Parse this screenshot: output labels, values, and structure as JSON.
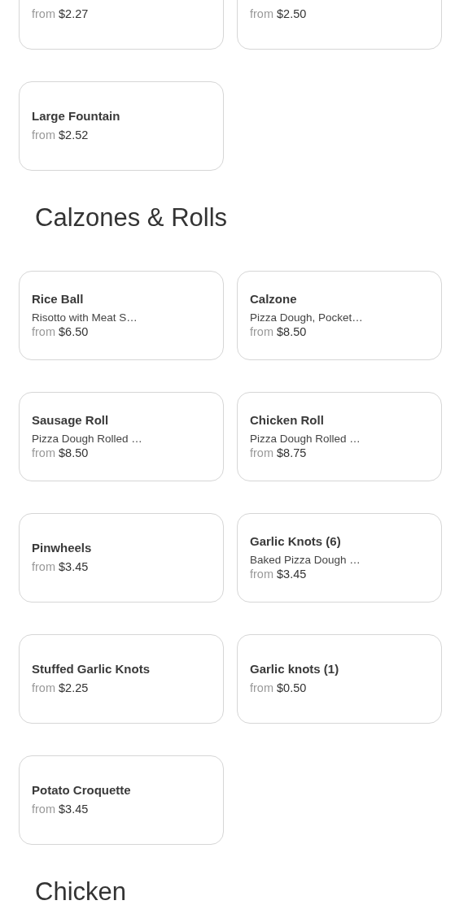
{
  "sections": [
    {
      "items": [
        {
          "from_label": "from",
          "price": "$2.27"
        },
        {
          "from_label": "from",
          "price": "$2.50"
        },
        {
          "name": "Large Fountain",
          "from_label": "from",
          "price": "$2.52"
        }
      ]
    },
    {
      "heading": "Calzones & Rolls",
      "items": [
        {
          "name": "Rice Ball",
          "description": "Risotto with Meat S…",
          "from_label": "from",
          "price": "$6.50"
        },
        {
          "name": "Calzone",
          "description": "Pizza Dough, Pocket…",
          "from_label": "from",
          "price": "$8.50"
        },
        {
          "name": "Sausage Roll",
          "description": "Pizza Dough Rolled …",
          "from_label": "from",
          "price": "$8.50"
        },
        {
          "name": "Chicken Roll",
          "description": "Pizza Dough Rolled …",
          "from_label": "from",
          "price": "$8.75"
        },
        {
          "name": "Pinwheels",
          "from_label": "from",
          "price": "$3.45"
        },
        {
          "name": "Garlic Knots (6)",
          "description": "Baked Pizza Dough …",
          "from_label": "from",
          "price": "$3.45"
        },
        {
          "name": "Stuffed Garlic Knots",
          "from_label": "from",
          "price": "$2.25"
        },
        {
          "name": "Garlic knots (1)",
          "from_label": "from",
          "price": "$0.50"
        },
        {
          "name": "Potato Croquette",
          "from_label": "from",
          "price": "$3.45"
        }
      ]
    },
    {
      "heading": "Chicken"
    }
  ]
}
